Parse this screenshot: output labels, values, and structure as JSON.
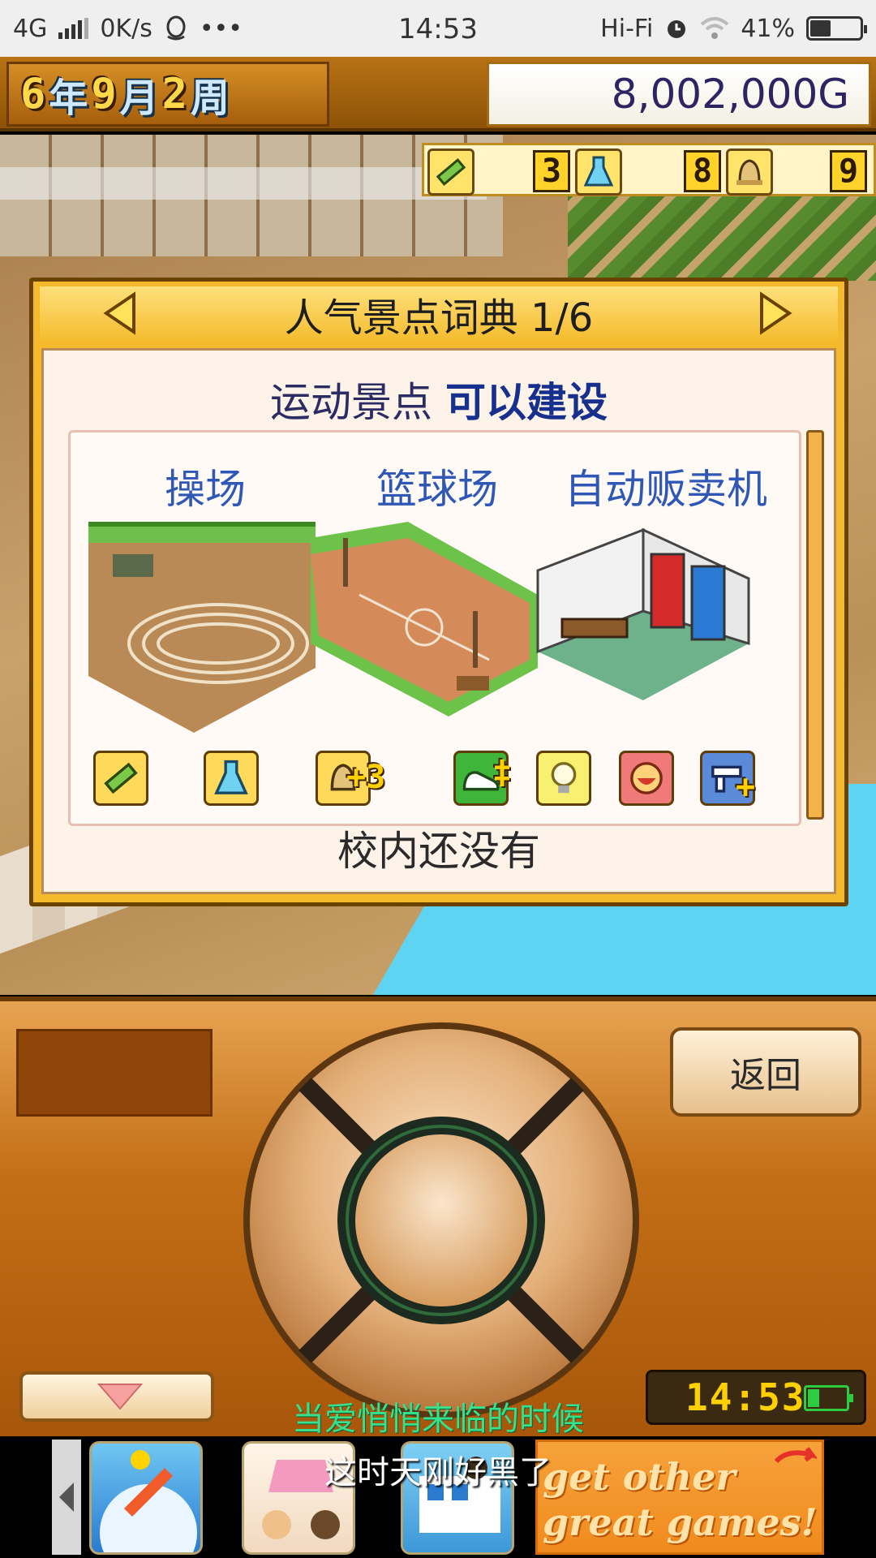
{
  "status_bar": {
    "network": "4G",
    "speed": "0K/s",
    "more": "•••",
    "time": "14:53",
    "hifi": "Hi-Fi",
    "battery_pct": "41%",
    "battery_level": 0.41
  },
  "date": {
    "year": "6",
    "year_unit": "年",
    "month": "9",
    "month_unit": "月",
    "week": "2",
    "week_unit": "周"
  },
  "money": "8,002,000G",
  "resources": [
    {
      "icon": "pencil-icon",
      "value": "3"
    },
    {
      "icon": "flask-icon",
      "value": "8"
    },
    {
      "icon": "bell-icon",
      "value": "9"
    }
  ],
  "dialog": {
    "title": "人气景点词典 1/6",
    "category": "运动景点",
    "status": "可以建设",
    "spots": [
      {
        "name": "操场",
        "image": "running-track"
      },
      {
        "name": "篮球场",
        "image": "basketball-court"
      },
      {
        "name": "自动贩卖机",
        "image": "vending-machine"
      }
    ],
    "bonuses": [
      {
        "icon": "pencil-icon",
        "plus": ""
      },
      {
        "icon": "flask-icon",
        "plus": ""
      },
      {
        "icon": "bell-icon",
        "plus": "+3"
      },
      {
        "icon": "sneaker-icon",
        "plus": "‡"
      },
      {
        "icon": "lightbulb-icon",
        "plus": ""
      },
      {
        "icon": "smiley-icon",
        "plus": ""
      },
      {
        "icon": "tool-icon",
        "plus": "+"
      }
    ],
    "footer": "校内还没有"
  },
  "controls": {
    "back_label": "返回",
    "clock": "14:53",
    "battery_level": 0.3
  },
  "subtitles": {
    "line1": "当爱悄悄来临的时候",
    "line2": "这时天刚好黑了"
  },
  "ad": {
    "cta_line1": "get other",
    "cta_line2": "great games!"
  },
  "colors": {
    "accent_gold": "#f5b92c",
    "panel_orange": "#c36f16",
    "status_blue": "#17308e",
    "subtitle_green": "#37e08c"
  }
}
